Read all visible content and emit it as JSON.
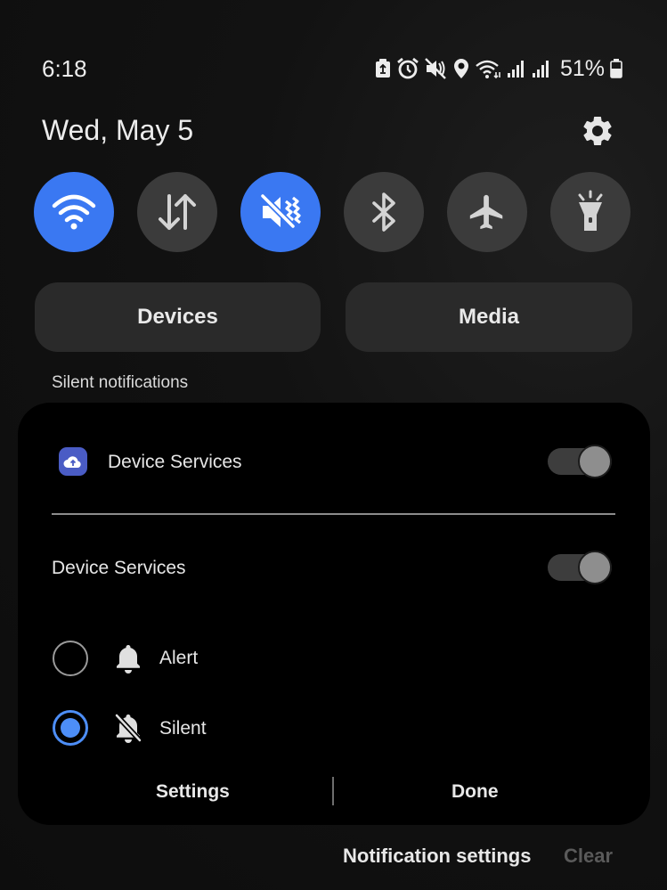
{
  "status_bar": {
    "time": "6:18",
    "battery_percent": "51%",
    "icons": [
      "battery-saver-icon",
      "alarm-icon",
      "mute-icon",
      "location-icon",
      "wifi-icon",
      "signal-icon",
      "signal-icon",
      "battery-icon"
    ]
  },
  "date": "Wed, May 5",
  "quick_toggles": [
    {
      "name": "wifi",
      "state": "on",
      "icon": "wifi-icon"
    },
    {
      "name": "mobile-data",
      "state": "off",
      "icon": "data-arrows-icon"
    },
    {
      "name": "mute",
      "state": "on",
      "icon": "mute-icon"
    },
    {
      "name": "bluetooth",
      "state": "off",
      "icon": "bluetooth-icon"
    },
    {
      "name": "airplane-mode",
      "state": "off",
      "icon": "airplane-icon"
    },
    {
      "name": "flashlight",
      "state": "off",
      "icon": "flashlight-icon"
    }
  ],
  "buttons": {
    "devices": "Devices",
    "media": "Media"
  },
  "section_label": "Silent notifications",
  "card": {
    "app_name": "Device Services",
    "channel_name": "Device Services",
    "app_switch": true,
    "channel_switch": true,
    "options": [
      {
        "label": "Alert",
        "selected": false,
        "icon": "bell-icon"
      },
      {
        "label": "Silent",
        "selected": true,
        "icon": "bell-off-icon"
      }
    ],
    "settings_label": "Settings",
    "done_label": "Done"
  },
  "footer": {
    "notification_settings": "Notification settings",
    "clear": "Clear"
  },
  "colors": {
    "accent": "#3a78f2",
    "radio_accent": "#4d8ef7",
    "background": "#121212",
    "card": "#000000"
  }
}
